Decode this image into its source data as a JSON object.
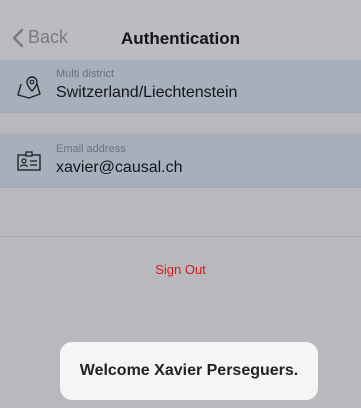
{
  "nav": {
    "back_label": "Back",
    "title": "Authentication"
  },
  "district": {
    "label": "Multi district",
    "value": "Switzerland/Liechtenstein",
    "icon": "map-pin-icon"
  },
  "email": {
    "label": "Email address",
    "value": "xavier@causal.ch",
    "icon": "id-card-icon"
  },
  "sign_out_label": "Sign Out",
  "toast_message": "Welcome Xavier Perseguers.",
  "colors": {
    "background": "#b9b9bd",
    "row_highlight": "#a6b0bc",
    "sign_out": "#d61b1b",
    "toast_bg": "#f5f5f5"
  }
}
